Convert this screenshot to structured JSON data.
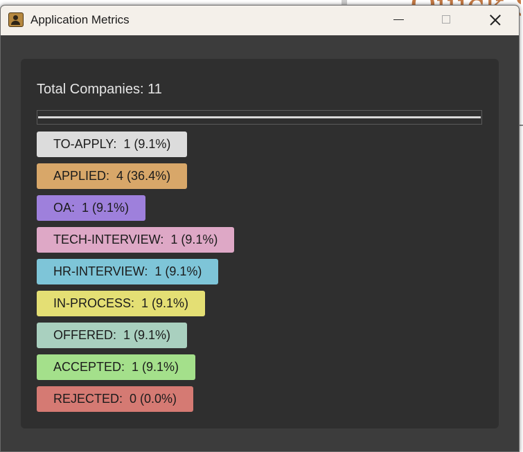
{
  "background_app": {
    "heading": "Quick S"
  },
  "window": {
    "title": "Application Metrics",
    "icon": "address-book-icon",
    "controls": {
      "minimize": "minimize-icon",
      "maximize": "maximize-icon",
      "close": "close-icon"
    }
  },
  "metrics": {
    "total_label": "Total Companies: 11",
    "progress_fraction": 1.0,
    "statuses": [
      {
        "label": "TO-APPLY:  1 (9.1%)",
        "color": "#dcdcdc"
      },
      {
        "label": "APPLIED:  4 (36.4%)",
        "color": "#d8a769"
      },
      {
        "label": "OA:  1 (9.1%)",
        "color": "#9e80dc"
      },
      {
        "label": "TECH-INTERVIEW:  1 (9.1%)",
        "color": "#dea8c6"
      },
      {
        "label": "HR-INTERVIEW:  1 (9.1%)",
        "color": "#7ec5d8"
      },
      {
        "label": "IN-PROCESS:  1 (9.1%)",
        "color": "#e4df74"
      },
      {
        "label": "OFFERED:  1 (9.1%)",
        "color": "#a9d0bf"
      },
      {
        "label": "ACCEPTED:  1 (9.1%)",
        "color": "#a4e08b"
      },
      {
        "label": "REJECTED:  0 (0.0%)",
        "color": "#d57a73"
      }
    ]
  }
}
